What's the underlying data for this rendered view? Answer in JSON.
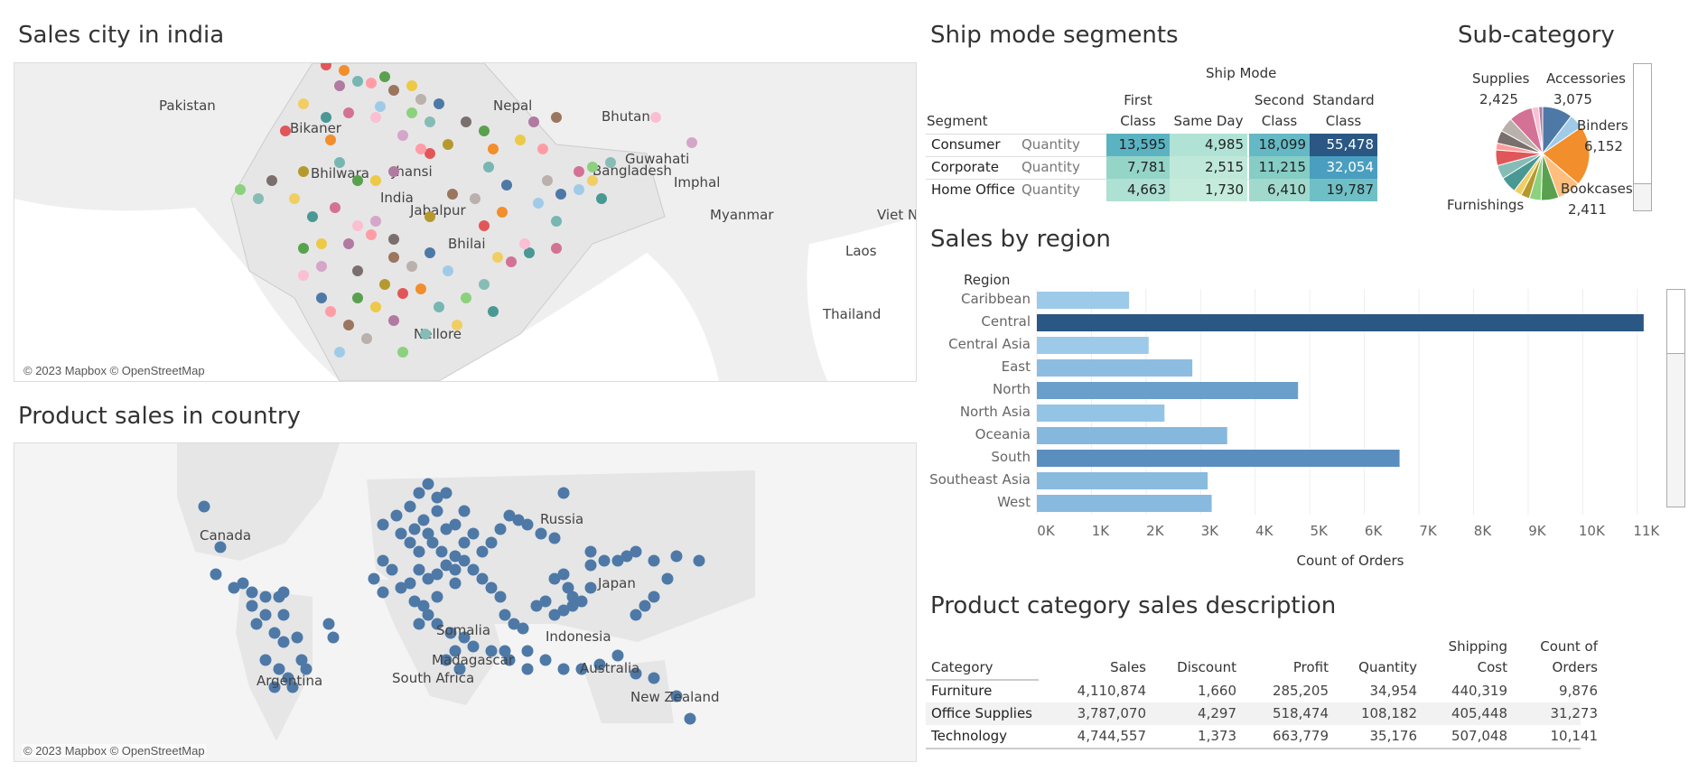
{
  "titles": {
    "sales_city": "Sales city in india",
    "product_country": "Product sales in country",
    "ship_mode": "Ship mode segments",
    "sub_category": "Sub-category",
    "sales_region": "Sales by region",
    "category_desc": "Product category sales description"
  },
  "map_attribution": "© 2023 Mapbox © OpenStreetMap",
  "india_map": {
    "labels": [
      "Pakistan",
      "Nepal",
      "Bhutan",
      "Bikaner",
      "Bhilwara",
      "Jhansi",
      "India",
      "Guwahati",
      "Imphal",
      "Bangladesh",
      "Jabalpur",
      "Bhilai",
      "Myanmar",
      "Viet N",
      "Laos",
      "Thailand",
      "Nellore"
    ],
    "dot_palette": [
      "#e15759",
      "#f28e2b",
      "#76b7b2",
      "#59a14f",
      "#edc948",
      "#b07aa1",
      "#ff9da7",
      "#9c755f",
      "#bab0ac",
      "#4e79a7",
      "#a0cbe8",
      "#8cd17d",
      "#86bcb6",
      "#f1ce63",
      "#499894",
      "#d37295",
      "#fabfd2",
      "#d4a6c8",
      "#79706e",
      "#b6992d"
    ]
  },
  "world_map": {
    "labels": [
      "Canada",
      "Russia",
      "Japan",
      "Somalia",
      "Indonesia",
      "Madagascar",
      "Argentina",
      "South Africa",
      "Australia",
      "New Zealand"
    ],
    "dot_color": "#4e79a7"
  },
  "ship_mode": {
    "header": "Ship Mode",
    "row_header": "Segment",
    "columns": [
      [
        "First",
        "Class"
      ],
      [
        "",
        "Same Day"
      ],
      [
        "Second",
        "Class"
      ],
      [
        "Standard",
        "Class"
      ]
    ],
    "measure": "Quantity",
    "rows": [
      {
        "segment": "Consumer",
        "values": [
          "13,595",
          "4,985",
          "18,099",
          "55,478"
        ],
        "colors": [
          "#5bb3c1",
          "#b0e3d5",
          "#64b9c4",
          "#2a5783"
        ]
      },
      {
        "segment": "Corporate",
        "values": [
          "7,781",
          "2,515",
          "11,215",
          "32,054"
        ],
        "colors": [
          "#95d5c8",
          "#bfe8da",
          "#85cdc5",
          "#4a9ebf"
        ]
      },
      {
        "segment": "Home Office",
        "values": [
          "4,663",
          "1,730",
          "6,410",
          "19,787"
        ],
        "colors": [
          "#aee0d3",
          "#c5ebdd",
          "#a1dacd",
          "#6fbfc6"
        ]
      }
    ]
  },
  "sub_category": {
    "labels": [
      {
        "name": "Supplies",
        "value": "2,425"
      },
      {
        "name": "Accessories",
        "value": "3,075"
      },
      {
        "name": "Binders",
        "value": "6,152"
      },
      {
        "name": "Bookcases",
        "value": "2,411"
      },
      {
        "name": "Furnishings",
        "value": ""
      }
    ]
  },
  "chart_data": {
    "type": "bar",
    "orientation": "horizontal",
    "ylabel": "Region",
    "xlabel": "Count of Orders",
    "categories": [
      "Caribbean",
      "Central",
      "Central Asia",
      "East",
      "North",
      "North Asia",
      "Oceania",
      "South",
      "Southeast Asia",
      "West"
    ],
    "values": [
      1690,
      11117,
      2048,
      2848,
      4785,
      2338,
      3487,
      6645,
      3129,
      3203
    ],
    "colors": [
      "#9ecae9",
      "#2a5783",
      "#9ecae9",
      "#8cbde0",
      "#6a9fcb",
      "#94c4e5",
      "#86b8dd",
      "#5a8ebf",
      "#89bbdf",
      "#88badf"
    ],
    "xlim": [
      0,
      11500
    ],
    "ticks": [
      0,
      1000,
      2000,
      3000,
      4000,
      5000,
      6000,
      7000,
      8000,
      9000,
      10000,
      11000
    ],
    "tick_labels": [
      "0K",
      "1K",
      "2K",
      "3K",
      "4K",
      "5K",
      "6K",
      "7K",
      "8K",
      "9K",
      "10K",
      "11K"
    ],
    "grid": true
  },
  "category_table": {
    "headers": [
      [
        "",
        "Category"
      ],
      [
        "",
        "Sales"
      ],
      [
        "",
        "Discount"
      ],
      [
        "",
        "Profit"
      ],
      [
        "",
        "Quantity"
      ],
      [
        "Shipping",
        "Cost"
      ],
      [
        "Count of",
        "Orders"
      ]
    ],
    "rows": [
      [
        "Furniture",
        "4,110,874",
        "1,660",
        "285,205",
        "34,954",
        "440,319",
        "9,876"
      ],
      [
        "Office Supplies",
        "3,787,070",
        "4,297",
        "518,474",
        "108,182",
        "405,448",
        "31,273"
      ],
      [
        "Technology",
        "4,744,557",
        "1,373",
        "663,779",
        "35,176",
        "507,048",
        "10,141"
      ]
    ]
  }
}
